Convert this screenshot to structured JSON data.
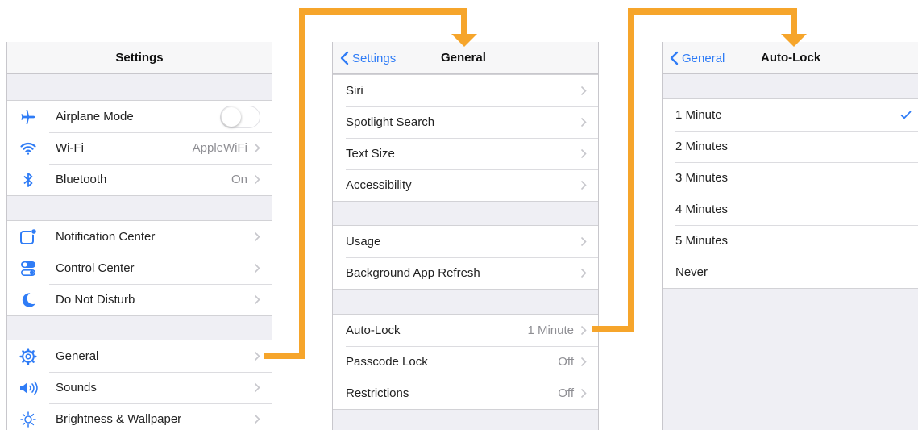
{
  "colors": {
    "accent": "#2f7cf6",
    "arrow": "#f6a52b"
  },
  "screen1": {
    "title": "Settings",
    "groups": [
      [
        {
          "icon": "airplane-icon",
          "label": "Airplane Mode",
          "toggle": "off"
        },
        {
          "icon": "wifi-icon",
          "label": "Wi-Fi",
          "value": "AppleWiFi"
        },
        {
          "icon": "bluetooth-icon",
          "label": "Bluetooth",
          "value": "On"
        }
      ],
      [
        {
          "icon": "notification-center-icon",
          "label": "Notification Center"
        },
        {
          "icon": "control-center-icon",
          "label": "Control Center"
        },
        {
          "icon": "moon-icon",
          "label": "Do Not Disturb"
        }
      ],
      [
        {
          "icon": "gear-icon",
          "label": "General"
        },
        {
          "icon": "speaker-icon",
          "label": "Sounds"
        },
        {
          "icon": "brightness-icon",
          "label": "Brightness & Wallpaper"
        }
      ]
    ]
  },
  "screen2": {
    "back": "Settings",
    "title": "General",
    "groups": [
      [
        {
          "label": "Siri"
        },
        {
          "label": "Spotlight Search"
        },
        {
          "label": "Text Size"
        },
        {
          "label": "Accessibility"
        }
      ],
      [
        {
          "label": "Usage"
        },
        {
          "label": "Background App Refresh"
        }
      ],
      [
        {
          "label": "Auto-Lock",
          "value": "1 Minute"
        },
        {
          "label": "Passcode Lock",
          "value": "Off"
        },
        {
          "label": "Restrictions",
          "value": "Off"
        }
      ]
    ]
  },
  "screen3": {
    "back": "General",
    "title": "Auto-Lock",
    "options": [
      "1 Minute",
      "2 Minutes",
      "3 Minutes",
      "4 Minutes",
      "5 Minutes",
      "Never"
    ],
    "selected": "1 Minute"
  }
}
